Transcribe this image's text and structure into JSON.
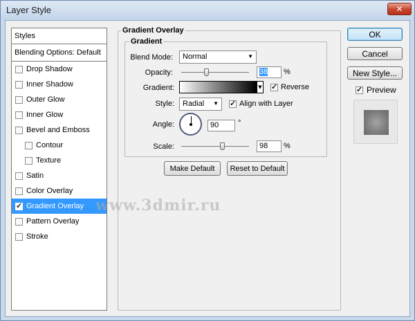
{
  "window": {
    "title": "Layer Style",
    "close_label": "✕"
  },
  "sidebar": {
    "header": "Styles",
    "blending_options": "Blending Options: Default",
    "items": [
      {
        "label": "Drop Shadow",
        "checked": false,
        "sub": false,
        "selected": false
      },
      {
        "label": "Inner Shadow",
        "checked": false,
        "sub": false,
        "selected": false
      },
      {
        "label": "Outer Glow",
        "checked": false,
        "sub": false,
        "selected": false
      },
      {
        "label": "Inner Glow",
        "checked": false,
        "sub": false,
        "selected": false
      },
      {
        "label": "Bevel and Emboss",
        "checked": false,
        "sub": false,
        "selected": false
      },
      {
        "label": "Contour",
        "checked": false,
        "sub": true,
        "selected": false
      },
      {
        "label": "Texture",
        "checked": false,
        "sub": true,
        "selected": false
      },
      {
        "label": "Satin",
        "checked": false,
        "sub": false,
        "selected": false
      },
      {
        "label": "Color Overlay",
        "checked": false,
        "sub": false,
        "selected": false
      },
      {
        "label": "Gradient Overlay",
        "checked": true,
        "sub": false,
        "selected": true
      },
      {
        "label": "Pattern Overlay",
        "checked": false,
        "sub": false,
        "selected": false
      },
      {
        "label": "Stroke",
        "checked": false,
        "sub": false,
        "selected": false
      }
    ]
  },
  "panel": {
    "group_title": "Gradient Overlay",
    "subgroup_title": "Gradient",
    "blend_mode": {
      "label": "Blend Mode:",
      "value": "Normal"
    },
    "opacity": {
      "label": "Opacity:",
      "value": "38",
      "unit": "%",
      "level": 0.38
    },
    "gradient": {
      "label": "Gradient:",
      "reverse_label": "Reverse",
      "reverse": true,
      "start_color": "#ffffff",
      "end_color": "#000000"
    },
    "style": {
      "label": "Style:",
      "value": "Radial",
      "align_label": "Align with Layer",
      "align": true
    },
    "angle": {
      "label": "Angle:",
      "value": "90",
      "unit": "°"
    },
    "scale": {
      "label": "Scale:",
      "value": "98",
      "unit": "%",
      "level": 0.98
    },
    "make_default": "Make Default",
    "reset_default": "Reset to Default"
  },
  "actions": {
    "ok": "OK",
    "cancel": "Cancel",
    "new_style": "New Style...",
    "preview_label": "Preview",
    "preview_checked": true
  },
  "watermark": "www.3dmir.ru"
}
